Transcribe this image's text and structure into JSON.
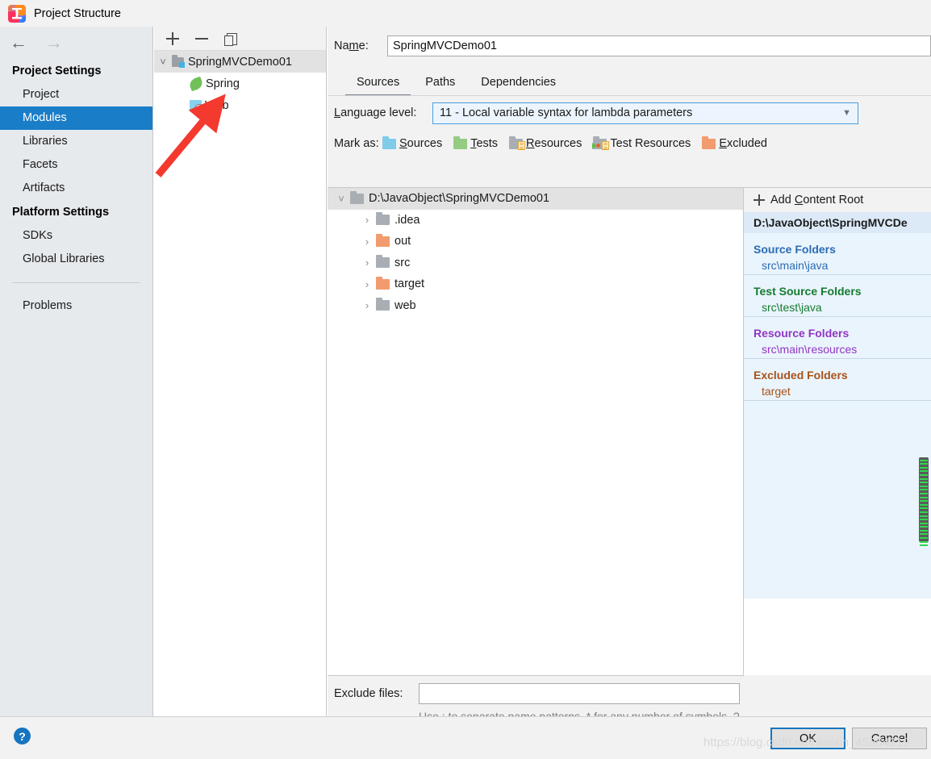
{
  "window": {
    "title": "Project Structure",
    "logo_icon": "intellij-idea-logo"
  },
  "sidebar": {
    "back_icon": "arrow-left-icon",
    "forward_icon": "arrow-right-icon",
    "groups": [
      {
        "label": "Project Settings",
        "items": [
          {
            "label": "Project",
            "selected": false
          },
          {
            "label": "Modules",
            "selected": true
          },
          {
            "label": "Libraries",
            "selected": false
          },
          {
            "label": "Facets",
            "selected": false
          },
          {
            "label": "Artifacts",
            "selected": false
          }
        ]
      },
      {
        "label": "Platform Settings",
        "items": [
          {
            "label": "SDKs",
            "selected": false
          },
          {
            "label": "Global Libraries",
            "selected": false
          }
        ]
      }
    ],
    "problems": "Problems",
    "selected_color": "#1a7dc8"
  },
  "module_panel": {
    "toolbar": {
      "add": "add-module",
      "remove": "remove-module",
      "copy": "copy-module"
    },
    "tree": [
      {
        "label": "SpringMVCDemo01",
        "icon": "module-folder-icon",
        "level": 0,
        "twisty": "v",
        "selected": true
      },
      {
        "label": "Spring",
        "icon": "spring-leaf-icon",
        "level": 1,
        "twisty": "",
        "selected": false
      },
      {
        "label": "Web",
        "icon": "web-module-icon",
        "level": 1,
        "twisty": "",
        "selected": false
      }
    ]
  },
  "main": {
    "name_label": "Name:",
    "name_label_pre": "Na",
    "name_label_mnemonic": "m",
    "name_label_post": "e:",
    "name_value": "SpringMVCDemo01",
    "tabs": [
      {
        "label": "Sources",
        "active": true
      },
      {
        "label": "Paths",
        "active": false
      },
      {
        "label": "Dependencies",
        "active": false
      }
    ],
    "language_level": {
      "label_pre": "L",
      "label_post": "anguage level:",
      "value": "11 - Local variable syntax for lambda parameters",
      "chevron_icon": "chevron-down-icon"
    },
    "mark_as": {
      "label": "Mark as:",
      "options": [
        {
          "label": "Sources",
          "mnemonic": "S",
          "rest": "ources",
          "color": "#7fcbe8",
          "icon": "sources-folder-icon"
        },
        {
          "label": "Tests",
          "mnemonic": "T",
          "rest": "ests",
          "color": "#93cc82",
          "icon": "tests-folder-icon"
        },
        {
          "label": "Resources",
          "mnemonic": "R",
          "rest": "esources",
          "color": "#a8aeb3",
          "icon": "resources-folder-icon"
        },
        {
          "label": "Test Resources",
          "mnemonic": "",
          "rest": "Test Resources",
          "color": "#a8aeb3",
          "icon": "test-resources-folder-icon"
        },
        {
          "label": "Excluded",
          "mnemonic": "E",
          "rest": "xcluded",
          "color": "#f29b6e",
          "icon": "excluded-folder-icon"
        }
      ]
    },
    "file_tree": [
      {
        "label": "D:\\JavaObject\\SpringMVCDemo01",
        "twisty": "v",
        "level": 0,
        "color": "gray",
        "selected": true
      },
      {
        "label": ".idea",
        "twisty": ">",
        "level": 1,
        "color": "gray",
        "selected": false
      },
      {
        "label": "out",
        "twisty": ">",
        "level": 1,
        "color": "orange",
        "selected": false
      },
      {
        "label": "src",
        "twisty": ">",
        "level": 1,
        "color": "gray",
        "selected": false
      },
      {
        "label": "target",
        "twisty": ">",
        "level": 1,
        "color": "orange",
        "selected": false
      },
      {
        "label": "web",
        "twisty": ">",
        "level": 1,
        "color": "gray",
        "selected": false
      }
    ],
    "details": {
      "add_content_root_pre": "Add ",
      "add_content_root_mnemonic": "C",
      "add_content_root_post": "ontent Root",
      "content_root": "D:\\JavaObject\\SpringMVCDe",
      "sections": [
        {
          "title": "Source Folders",
          "kind": "src",
          "entries": [
            "src\\main\\java"
          ]
        },
        {
          "title": "Test Source Folders",
          "kind": "test",
          "entries": [
            "src\\test\\java"
          ]
        },
        {
          "title": "Resource Folders",
          "kind": "res",
          "entries": [
            "src\\main\\resources"
          ]
        },
        {
          "title": "Excluded Folders",
          "kind": "exc",
          "entries": [
            "target"
          ]
        }
      ]
    },
    "exclude_files": {
      "label": "Exclude files:",
      "value": "",
      "hint": "Use ; to separate name patterns, * for any number of symbols, ? for one."
    },
    "scrollbar": {
      "name": "error-stripe-scrollbar"
    }
  },
  "bottom": {
    "help_icon": "?",
    "ok_label": "OK",
    "ok_mnemonic_index": 0,
    "cancel_label": "Cancel"
  },
  "annotation": {
    "arrow_color": "#f4392f",
    "arrow_name": "red-annotation-arrow"
  },
  "watermark": {
    "text": "https://blog.csdn.net/weixin_45964319"
  }
}
